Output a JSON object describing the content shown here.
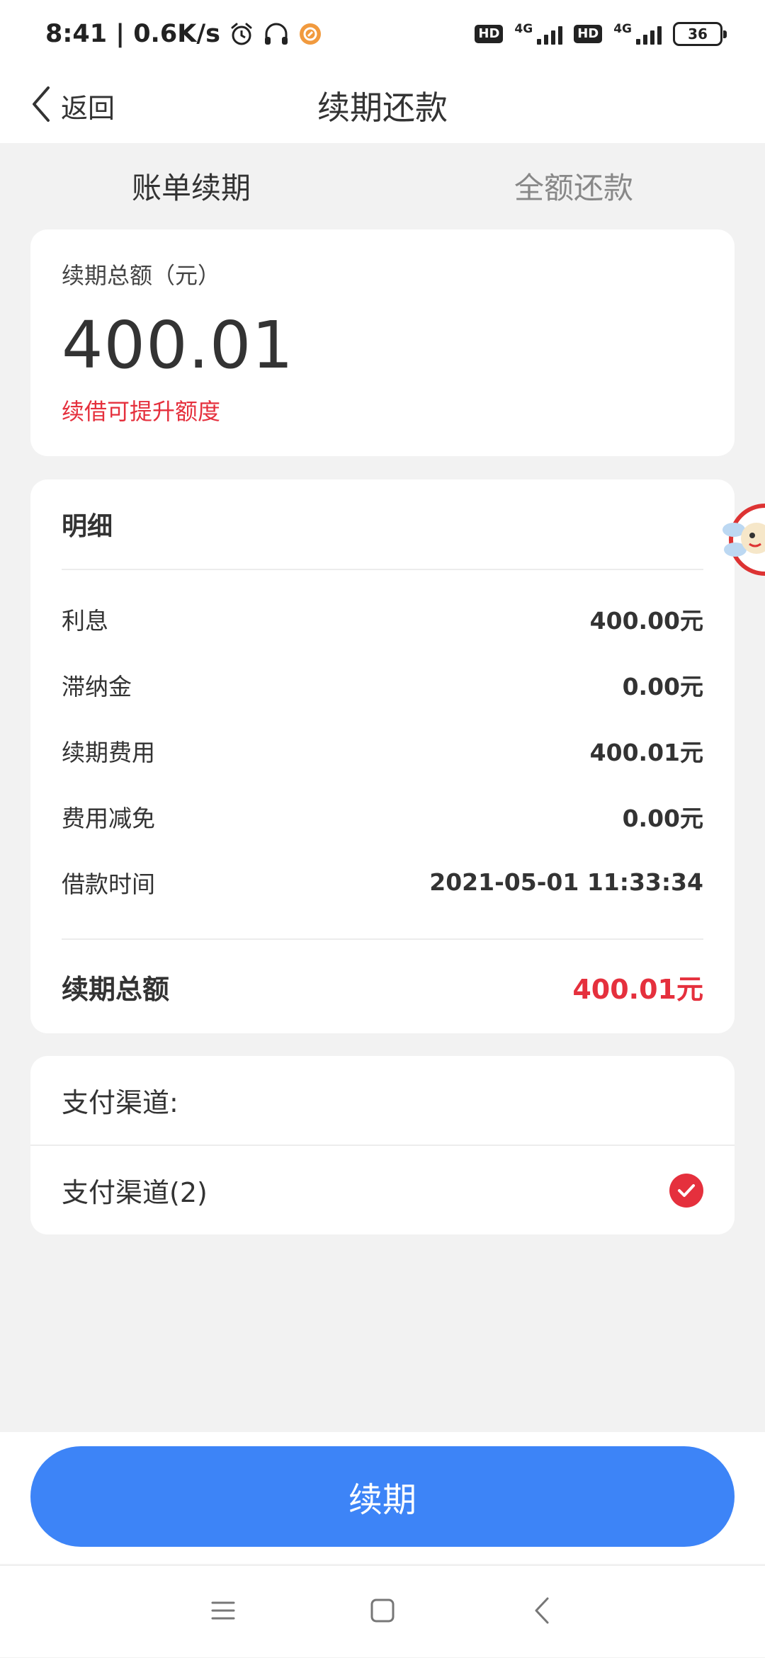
{
  "status_bar": {
    "time_speed": "8:41 | 0.6K/s",
    "hd_badge_1": "HD",
    "network_1": "4G",
    "hd_badge_2": "HD",
    "network_2": "4G",
    "battery": "36",
    "icons": [
      "alarm-icon",
      "headset-icon",
      "app-notification-icon",
      "signal-icon",
      "battery-icon"
    ]
  },
  "nav": {
    "back_label": "返回",
    "title": "续期还款"
  },
  "tabs": [
    {
      "label": "账单续期",
      "active": true
    },
    {
      "label": "全额还款",
      "active": false
    }
  ],
  "total_card": {
    "caption": "续期总额（元）",
    "amount": "400.01",
    "hint": "续借可提升额度"
  },
  "detail_card": {
    "heading": "明细",
    "rows": [
      {
        "label": "利息",
        "value": "400.00元"
      },
      {
        "label": "滞纳金",
        "value": "0.00元"
      },
      {
        "label": "续期费用",
        "value": "400.01元"
      },
      {
        "label": "费用减免",
        "value": "0.00元"
      },
      {
        "label": "借款时间",
        "value": "2021-05-01 11:33:34"
      }
    ],
    "summary_label": "续期总额",
    "summary_value": "400.01元"
  },
  "payment": {
    "heading": "支付渠道:",
    "option_label": "支付渠道(2)",
    "selected": true
  },
  "primary_action": {
    "label": "续期"
  },
  "colors": {
    "accent_blue": "#3d84f7",
    "alert_red": "#e5303d",
    "background": "#f2f2f2"
  }
}
